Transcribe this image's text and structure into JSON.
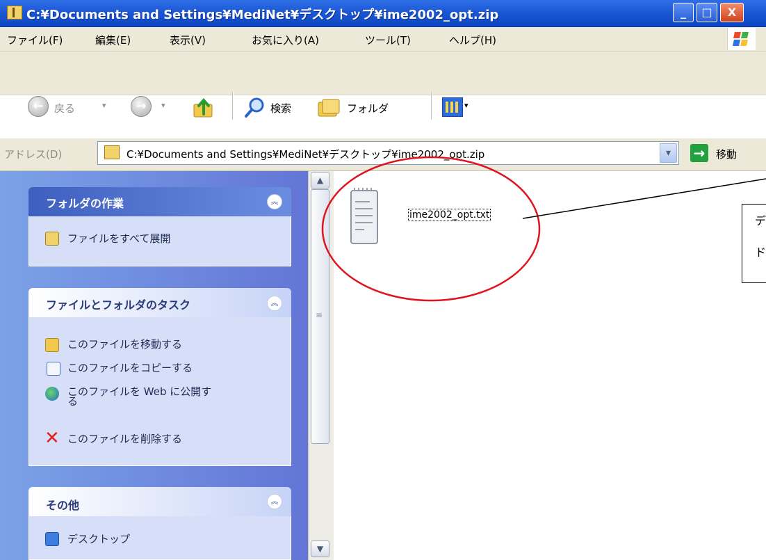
{
  "window": {
    "title": "C:¥Documents and Settings¥MediNet¥デスクトップ¥ime2002_opt.zip",
    "min_glyph": "_",
    "max_glyph": "□",
    "close_glyph": "X"
  },
  "menubar": {
    "items": [
      "ファイル(F)",
      "編集(E)",
      "表示(V)",
      "お気に入り(A)",
      "ツール(T)",
      "ヘルプ(H)"
    ]
  },
  "toolbar": {
    "back_label": "戻る",
    "back_glyph": "←",
    "forward_glyph": "→",
    "dropdown_glyph": "▾",
    "search_label": "検索",
    "folders_label": "フォルダ",
    "views_dropdown_glyph": "▾"
  },
  "address": {
    "label": "アドレス(D)",
    "value": "C:¥Documents and Settings¥MediNet¥デスクトップ¥ime2002_opt.zip",
    "dropdown_glyph": "▾",
    "go_glyph": "→",
    "go_label": "移動"
  },
  "taskpane": {
    "collapse_glyph": "︽",
    "panels": [
      {
        "title": "フォルダの作業",
        "items": [
          {
            "label": "ファイルをすべて展開",
            "icon": "extract-zip-icon"
          }
        ]
      },
      {
        "title": "ファイルとフォルダのタスク",
        "items": [
          {
            "label": "このファイルを移動する",
            "icon": "move-file-icon"
          },
          {
            "label": "このファイルをコピーする",
            "icon": "copy-file-icon"
          },
          {
            "label": "このファイルを Web に公開す",
            "label_line2": "る",
            "icon": "publish-web-icon"
          },
          {
            "label": "このファイルを削除する",
            "icon": "delete-icon"
          }
        ]
      },
      {
        "title": "その他",
        "items": [
          {
            "label": "デスクトップ",
            "icon": "desktop-icon"
          }
        ]
      }
    ]
  },
  "scrollbar": {
    "up_glyph": "▲",
    "down_glyph": "▼",
    "grip_glyph": "≡"
  },
  "files": [
    {
      "name": "ime2002_opt.txt",
      "icon": "text-document-icon",
      "selected": true
    }
  ],
  "annotation": {
    "text_line1": "デ",
    "text_line2": "ド",
    "highlight_color": "#e0141e"
  },
  "colors": {
    "titlebar": "#1b58d6",
    "taskpane_bg": "#6f8ee0",
    "panel_head_blue": "#3b5bb9",
    "go_green": "#22a13e"
  }
}
